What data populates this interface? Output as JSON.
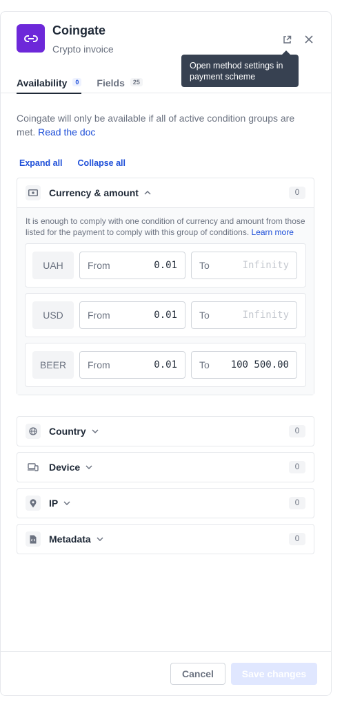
{
  "header": {
    "title": "Coingate",
    "subtitle": "Crypto invoice",
    "tooltip": "Open method settings in payment scheme"
  },
  "tabs": [
    {
      "label": "Availability",
      "badge": "0"
    },
    {
      "label": "Fields",
      "badge": "25"
    }
  ],
  "description": {
    "text": "Coingate will only be available if all of active condition groups are met.",
    "link": "Read the doc"
  },
  "actions": {
    "expand_all": "Expand all",
    "collapse_all": "Collapse all"
  },
  "currency_group": {
    "label": "Currency & amount",
    "count": "0",
    "note": "It is enough to comply with one condition of currency and amount from those listed for the payment to comply with this group of conditions.",
    "note_link": "Learn more",
    "rows": [
      {
        "currency": "UAH",
        "from_label": "From",
        "from_value": "0.01",
        "to_label": "To",
        "to_placeholder": "Infinity"
      },
      {
        "currency": "USD",
        "from_label": "From",
        "from_value": "0.01",
        "to_label": "To",
        "to_placeholder": "Infinity"
      },
      {
        "currency": "BEER",
        "from_label": "From",
        "from_value": "0.01",
        "to_label": "To",
        "to_value": "100 500.00"
      }
    ]
  },
  "groups": [
    {
      "label": "Country",
      "count": "0",
      "icon": "globe-icon"
    },
    {
      "label": "Device",
      "count": "0",
      "icon": "devices-icon"
    },
    {
      "label": "IP",
      "count": "0",
      "icon": "location-pin-icon"
    },
    {
      "label": "Metadata",
      "count": "0",
      "icon": "code-file-icon"
    }
  ],
  "footer": {
    "cancel": "Cancel",
    "save": "Save changes"
  },
  "colors": {
    "brand": "#6d28d9",
    "link": "#1d4ed8",
    "save_disabled": "#e0e7ff"
  }
}
